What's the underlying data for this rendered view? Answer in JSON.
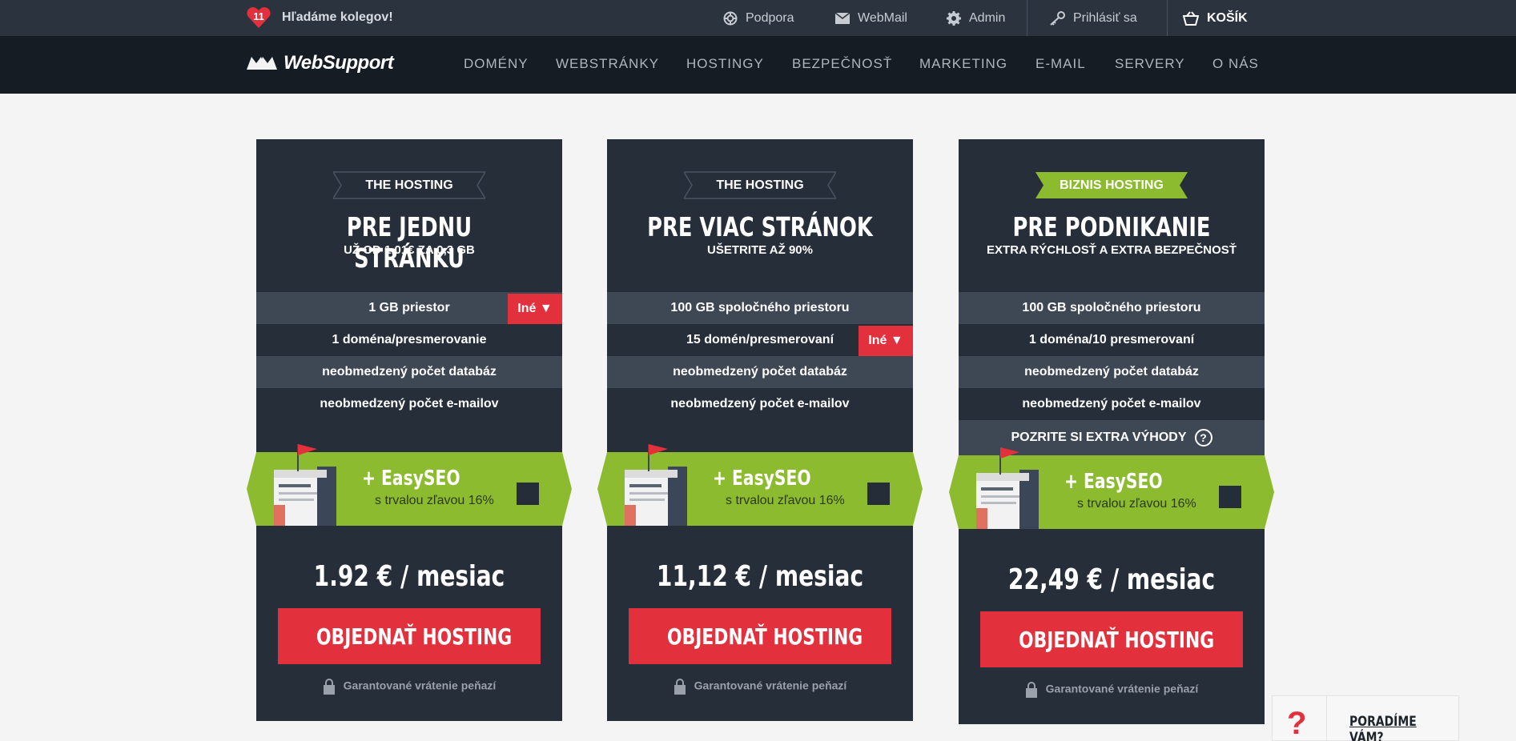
{
  "topbar": {
    "jobs_badge": "11",
    "jobs_text": "Hľadáme kolegov!",
    "support": "Podpora",
    "webmail": "WebMail",
    "admin": "Admin",
    "login": "Prihlásiť sa",
    "cart": "KOŠÍK"
  },
  "nav": {
    "logo": "WebSupport",
    "items": [
      "DOMÉNY",
      "WEBSTRÁNKY",
      "HOSTINGY",
      "BEZPEČNOSŤ",
      "MARKETING",
      "E-MAIL",
      "SERVERY",
      "O NÁS"
    ]
  },
  "plans": [
    {
      "ribbon": "THE HOSTING",
      "title": "PRE JEDNU STRÁNKU",
      "subtitle": "UŽ OD 1,01€ ZA 0,3 GB",
      "features": [
        "1 GB priestor",
        "1 doména/presmerovanie",
        "neobmedzený počet databáz",
        "neobmedzený počet e-mailov"
      ],
      "ine_label": "Iné ▼",
      "seo_title": "+ EasySEO",
      "seo_sub": "s trvalou zľavou 16%",
      "price": "1.92 € / mesiac",
      "order": "OBJEDNAŤ HOSTING",
      "guarantee": "Garantované vrátenie peňazí"
    },
    {
      "ribbon": "THE HOSTING",
      "title": "PRE VIAC STRÁNOK",
      "subtitle": "UŠETRITE AŽ 90%",
      "features": [
        "100 GB spoločného priestoru",
        "15 domén/presmerovaní",
        "neobmedzený počet databáz",
        "neobmedzený počet e-mailov"
      ],
      "ine_label": "Iné ▼",
      "seo_title": "+ EasySEO",
      "seo_sub": "s trvalou zľavou 16%",
      "price": "11,12 € / mesiac",
      "order": "OBJEDNAŤ HOSTING",
      "guarantee": "Garantované vrátenie peňazí"
    },
    {
      "ribbon": "BIZNIS HOSTING",
      "title": "PRE PODNIKANIE",
      "subtitle": "EXTRA RÝCHLOSŤ A EXTRA BEZPEČNOSŤ",
      "features": [
        "100 GB spoločného priestoru",
        "1 doména/10 presmerovaní",
        "neobmedzený počet databáz",
        "neobmedzený počet e-mailov"
      ],
      "extra": "POZRITE SI EXTRA VÝHODY",
      "extra_icon": "?",
      "seo_title": "+ EasySEO",
      "seo_sub": "s trvalou zľavou 16%",
      "price": "22,49 € / mesiac",
      "order": "OBJEDNAŤ HOSTING",
      "guarantee": "Garantované vrátenie peňazí"
    }
  ],
  "help": {
    "icon": "?",
    "label": "PORADÍME VÁM?"
  },
  "colors": {
    "accent_red": "#e3303d",
    "accent_green": "#8cbb2f",
    "card_bg": "#262e39",
    "topbar_bg": "#2b333e",
    "nav_bg": "#161c24"
  }
}
